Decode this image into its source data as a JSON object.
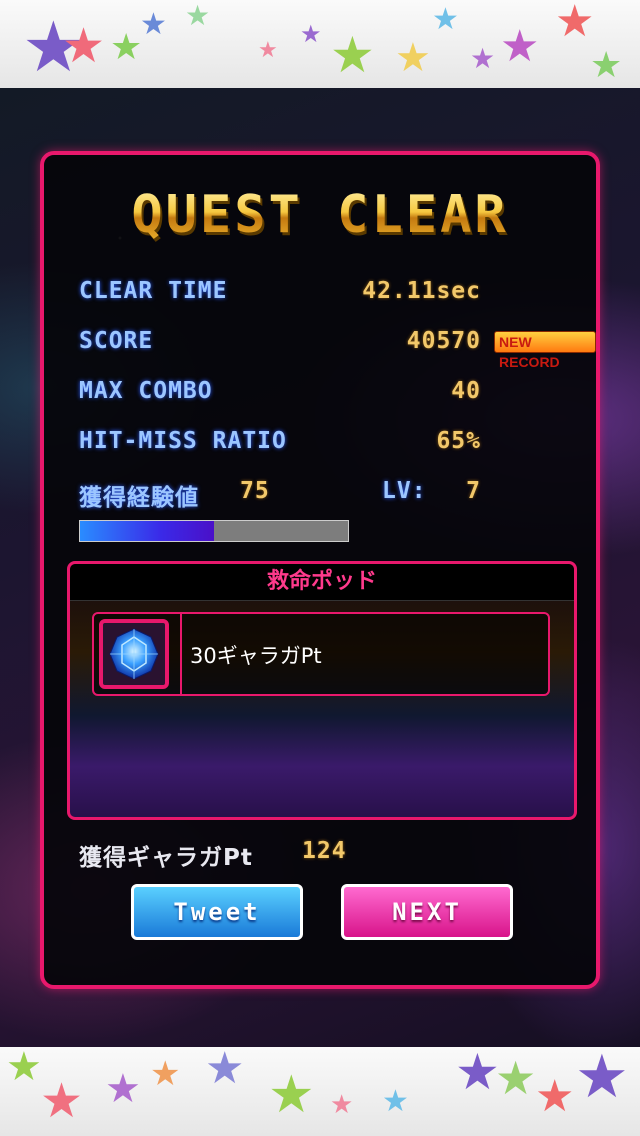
{
  "title": "QUEST CLEAR",
  "stats": {
    "clear_time": {
      "label": "CLEAR TIME",
      "value": "42.11sec"
    },
    "score": {
      "label": "SCORE",
      "value": "40570",
      "badge": "NEW RECORD"
    },
    "max_combo": {
      "label": "MAX COMBO",
      "value": "40"
    },
    "hit_miss": {
      "label": "HIT-MISS RATIO",
      "value": "65%"
    },
    "exp": {
      "label": "獲得経験値",
      "value": "75"
    },
    "level": {
      "label": "LV:",
      "value": "7"
    }
  },
  "exp_bar": {
    "progress": 0.5
  },
  "pod": {
    "title": "救命ポッド",
    "reward": {
      "icon": "blue-crystal-icon",
      "text": "30ギャラガPt"
    }
  },
  "galaga_pt": {
    "label": "獲得ギャラガPt",
    "value": "124"
  },
  "buttons": {
    "tweet": "Tweet",
    "next": "NEXT"
  },
  "colors": {
    "accent": "#e8186c",
    "label": "#9cc6ff",
    "value": "#f2c86a"
  }
}
